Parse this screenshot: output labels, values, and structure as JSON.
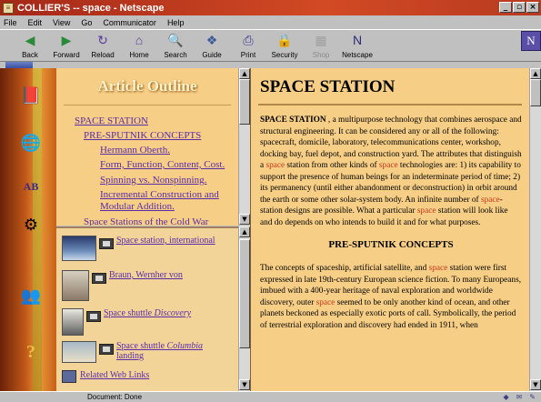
{
  "window": {
    "title": "COLLIER'S -- space - Netscape"
  },
  "menu": [
    "File",
    "Edit",
    "View",
    "Go",
    "Communicator",
    "Help"
  ],
  "toolbar": [
    {
      "label": "Back",
      "icon": "back-arrow-icon",
      "glyph": "◀",
      "color": "#2a8a3a"
    },
    {
      "label": "Forward",
      "icon": "forward-arrow-icon",
      "glyph": "▶",
      "color": "#2a8a3a"
    },
    {
      "label": "Reload",
      "icon": "reload-icon",
      "glyph": "↻",
      "color": "#5a3a9a"
    },
    {
      "label": "Home",
      "icon": "home-icon",
      "glyph": "⌂",
      "color": "#5a3a9a"
    },
    {
      "label": "Search",
      "icon": "search-icon",
      "glyph": "🔍",
      "color": "#3a5a9a"
    },
    {
      "label": "Guide",
      "icon": "guide-icon",
      "glyph": "❖",
      "color": "#3a5a9a"
    },
    {
      "label": "Print",
      "icon": "print-icon",
      "glyph": "⎙",
      "color": "#3a3a9a"
    },
    {
      "label": "Security",
      "icon": "security-lock-icon",
      "glyph": "🔒",
      "color": "#8a6a2a"
    },
    {
      "label": "Shop",
      "icon": "shop-icon",
      "glyph": "▦",
      "color": "#a0a0a0",
      "disabled": true
    },
    {
      "label": "Netscape",
      "icon": "netscape-icon",
      "glyph": "N",
      "color": "#2a2a7a"
    }
  ],
  "outline": {
    "heading": "Article Outline",
    "items": [
      "SPACE STATION",
      "PRE-SPUTNIK CONCEPTS",
      "Hermann Oberth.",
      "Form, Function, Content, Cost.",
      "Spinning vs. Nonspinning.",
      "Incremental Construction and",
      "Modular Addition.",
      "Space Stations of the Cold War"
    ]
  },
  "media": {
    "items": [
      {
        "label": "Space station, international",
        "italic": ""
      },
      {
        "label": "Braun, Wernher von",
        "italic": ""
      },
      {
        "label": "Space shuttle ",
        "italic": "Discovery"
      },
      {
        "label": "Space shuttle ",
        "italic": "Columbia",
        "label2": "landing"
      },
      {
        "label": "Related Web Links",
        "italic": ""
      }
    ]
  },
  "article": {
    "title": "SPACE STATION",
    "p1_lead": "SPACE STATION",
    "p1_a": " , a multipurpose technology that combines aerospace and structural engineering. It can be considered any or all of the following: spacecraft, domicile, laboratory, telecommunications center, workshop, docking bay, fuel depot, and construction yard. The attributes that distinguish a ",
    "hl": "space",
    "p1_b": " station from other kinds of ",
    "p1_c": " technologies are: 1) its capability to support the presence of human beings for an indeterminate period of time; 2) its permanency (until either abandonment or deconstruction) in orbit around the earth or some other solar-system body. An infinite number of ",
    "p1_d": "-station designs are possible. What a particular ",
    "p1_e": " station will look like and do depends on who intends to build it and for what purposes.",
    "h2": "PRE-SPUTNIK CONCEPTS",
    "p2_a": "The concepts of spaceship, artificial satellite, and ",
    "p2_b": " station were first expressed in late 19th-century European science fiction. To many Europeans, imbued with a 400-year heritage of naval exploration and worldwide discovery, outer ",
    "p2_c": " seemed to be only another kind of ocean, and other planets beckoned as especially exotic ports of call. Symbolically, the period of terrestrial exploration and discovery had ended in 1911, when"
  },
  "status": {
    "text": "Document: Done"
  }
}
